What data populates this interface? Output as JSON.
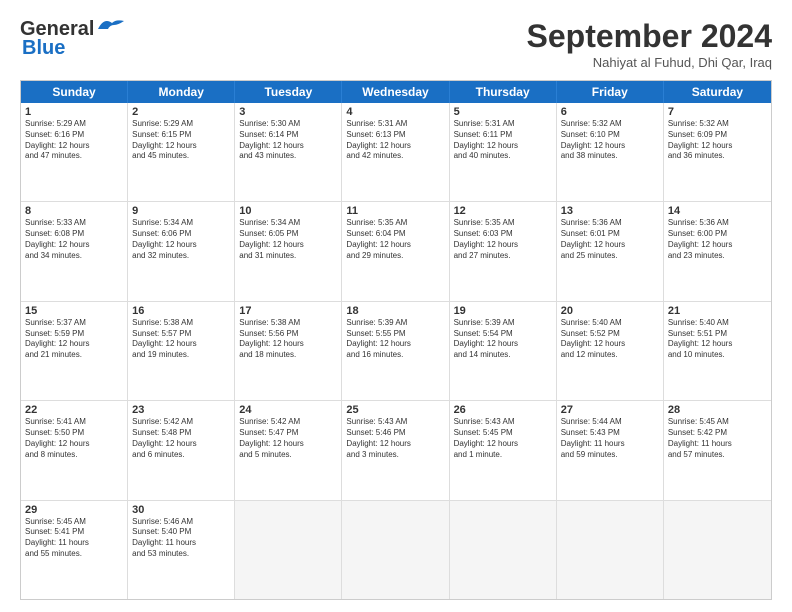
{
  "header": {
    "logo_line1": "General",
    "logo_line2": "Blue",
    "month_title": "September 2024",
    "subtitle": "Nahiyat al Fuhud, Dhi Qar, Iraq"
  },
  "days_of_week": [
    "Sunday",
    "Monday",
    "Tuesday",
    "Wednesday",
    "Thursday",
    "Friday",
    "Saturday"
  ],
  "weeks": [
    [
      {
        "day": "1",
        "lines": [
          "Sunrise: 5:29 AM",
          "Sunset: 6:16 PM",
          "Daylight: 12 hours",
          "and 47 minutes."
        ]
      },
      {
        "day": "2",
        "lines": [
          "Sunrise: 5:29 AM",
          "Sunset: 6:15 PM",
          "Daylight: 12 hours",
          "and 45 minutes."
        ]
      },
      {
        "day": "3",
        "lines": [
          "Sunrise: 5:30 AM",
          "Sunset: 6:14 PM",
          "Daylight: 12 hours",
          "and 43 minutes."
        ]
      },
      {
        "day": "4",
        "lines": [
          "Sunrise: 5:31 AM",
          "Sunset: 6:13 PM",
          "Daylight: 12 hours",
          "and 42 minutes."
        ]
      },
      {
        "day": "5",
        "lines": [
          "Sunrise: 5:31 AM",
          "Sunset: 6:11 PM",
          "Daylight: 12 hours",
          "and 40 minutes."
        ]
      },
      {
        "day": "6",
        "lines": [
          "Sunrise: 5:32 AM",
          "Sunset: 6:10 PM",
          "Daylight: 12 hours",
          "and 38 minutes."
        ]
      },
      {
        "day": "7",
        "lines": [
          "Sunrise: 5:32 AM",
          "Sunset: 6:09 PM",
          "Daylight: 12 hours",
          "and 36 minutes."
        ]
      }
    ],
    [
      {
        "day": "8",
        "lines": [
          "Sunrise: 5:33 AM",
          "Sunset: 6:08 PM",
          "Daylight: 12 hours",
          "and 34 minutes."
        ]
      },
      {
        "day": "9",
        "lines": [
          "Sunrise: 5:34 AM",
          "Sunset: 6:06 PM",
          "Daylight: 12 hours",
          "and 32 minutes."
        ]
      },
      {
        "day": "10",
        "lines": [
          "Sunrise: 5:34 AM",
          "Sunset: 6:05 PM",
          "Daylight: 12 hours",
          "and 31 minutes."
        ]
      },
      {
        "day": "11",
        "lines": [
          "Sunrise: 5:35 AM",
          "Sunset: 6:04 PM",
          "Daylight: 12 hours",
          "and 29 minutes."
        ]
      },
      {
        "day": "12",
        "lines": [
          "Sunrise: 5:35 AM",
          "Sunset: 6:03 PM",
          "Daylight: 12 hours",
          "and 27 minutes."
        ]
      },
      {
        "day": "13",
        "lines": [
          "Sunrise: 5:36 AM",
          "Sunset: 6:01 PM",
          "Daylight: 12 hours",
          "and 25 minutes."
        ]
      },
      {
        "day": "14",
        "lines": [
          "Sunrise: 5:36 AM",
          "Sunset: 6:00 PM",
          "Daylight: 12 hours",
          "and 23 minutes."
        ]
      }
    ],
    [
      {
        "day": "15",
        "lines": [
          "Sunrise: 5:37 AM",
          "Sunset: 5:59 PM",
          "Daylight: 12 hours",
          "and 21 minutes."
        ]
      },
      {
        "day": "16",
        "lines": [
          "Sunrise: 5:38 AM",
          "Sunset: 5:57 PM",
          "Daylight: 12 hours",
          "and 19 minutes."
        ]
      },
      {
        "day": "17",
        "lines": [
          "Sunrise: 5:38 AM",
          "Sunset: 5:56 PM",
          "Daylight: 12 hours",
          "and 18 minutes."
        ]
      },
      {
        "day": "18",
        "lines": [
          "Sunrise: 5:39 AM",
          "Sunset: 5:55 PM",
          "Daylight: 12 hours",
          "and 16 minutes."
        ]
      },
      {
        "day": "19",
        "lines": [
          "Sunrise: 5:39 AM",
          "Sunset: 5:54 PM",
          "Daylight: 12 hours",
          "and 14 minutes."
        ]
      },
      {
        "day": "20",
        "lines": [
          "Sunrise: 5:40 AM",
          "Sunset: 5:52 PM",
          "Daylight: 12 hours",
          "and 12 minutes."
        ]
      },
      {
        "day": "21",
        "lines": [
          "Sunrise: 5:40 AM",
          "Sunset: 5:51 PM",
          "Daylight: 12 hours",
          "and 10 minutes."
        ]
      }
    ],
    [
      {
        "day": "22",
        "lines": [
          "Sunrise: 5:41 AM",
          "Sunset: 5:50 PM",
          "Daylight: 12 hours",
          "and 8 minutes."
        ]
      },
      {
        "day": "23",
        "lines": [
          "Sunrise: 5:42 AM",
          "Sunset: 5:48 PM",
          "Daylight: 12 hours",
          "and 6 minutes."
        ]
      },
      {
        "day": "24",
        "lines": [
          "Sunrise: 5:42 AM",
          "Sunset: 5:47 PM",
          "Daylight: 12 hours",
          "and 5 minutes."
        ]
      },
      {
        "day": "25",
        "lines": [
          "Sunrise: 5:43 AM",
          "Sunset: 5:46 PM",
          "Daylight: 12 hours",
          "and 3 minutes."
        ]
      },
      {
        "day": "26",
        "lines": [
          "Sunrise: 5:43 AM",
          "Sunset: 5:45 PM",
          "Daylight: 12 hours",
          "and 1 minute."
        ]
      },
      {
        "day": "27",
        "lines": [
          "Sunrise: 5:44 AM",
          "Sunset: 5:43 PM",
          "Daylight: 11 hours",
          "and 59 minutes."
        ]
      },
      {
        "day": "28",
        "lines": [
          "Sunrise: 5:45 AM",
          "Sunset: 5:42 PM",
          "Daylight: 11 hours",
          "and 57 minutes."
        ]
      }
    ],
    [
      {
        "day": "29",
        "lines": [
          "Sunrise: 5:45 AM",
          "Sunset: 5:41 PM",
          "Daylight: 11 hours",
          "and 55 minutes."
        ]
      },
      {
        "day": "30",
        "lines": [
          "Sunrise: 5:46 AM",
          "Sunset: 5:40 PM",
          "Daylight: 11 hours",
          "and 53 minutes."
        ]
      },
      {
        "day": "",
        "lines": []
      },
      {
        "day": "",
        "lines": []
      },
      {
        "day": "",
        "lines": []
      },
      {
        "day": "",
        "lines": []
      },
      {
        "day": "",
        "lines": []
      }
    ]
  ]
}
